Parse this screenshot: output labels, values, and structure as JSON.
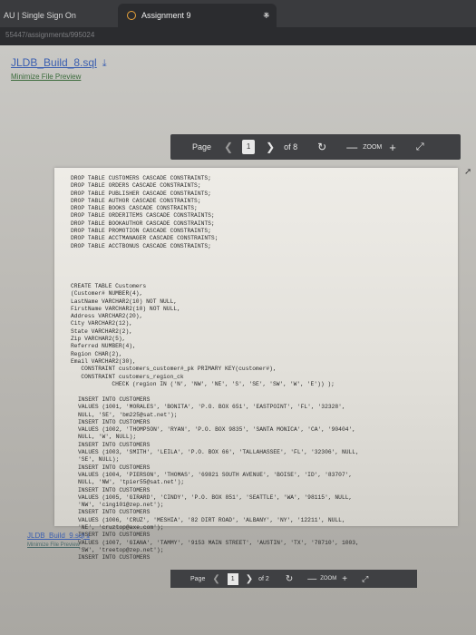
{
  "browser": {
    "tabs": [
      {
        "label": "AU | Single Sign On"
      },
      {
        "label": "Assignment 9"
      }
    ],
    "tab_close": "×",
    "new_tab": "+",
    "url": "55447/assignments/995024"
  },
  "file1": {
    "name": "JLDB_Build_8.sql",
    "minimize_label": "Minimize File Preview",
    "toolbar": {
      "page_label": "Page",
      "current_page": "1",
      "of_label": "of 8",
      "zoom_label": "ZOOM",
      "minus": "—",
      "plus": "+"
    }
  },
  "file2": {
    "name": "JLDB_Build_9.sql",
    "minimize_label": "Minimize File Preview",
    "toolbar": {
      "page_label": "Page",
      "current_page": "1",
      "of_label": "of 2",
      "zoom_label": "ZOOM",
      "minus": "—",
      "plus": "+"
    }
  },
  "icons": {
    "download": "download-icon",
    "prev": "chevron-left-icon",
    "next": "chevron-right-icon",
    "refresh": "refresh-icon",
    "expand": "expand-icon"
  },
  "document": {
    "drop_block": "DROP TABLE CUSTOMERS CASCADE CONSTRAINTS;\nDROP TABLE ORDERS CASCADE CONSTRAINTS;\nDROP TABLE PUBLISHER CASCADE CONSTRAINTS;\nDROP TABLE AUTHOR CASCADE CONSTRAINTS;\nDROP TABLE BOOKS CASCADE CONSTRAINTS;\nDROP TABLE ORDERITEMS CASCADE CONSTRAINTS;\nDROP TABLE BOOKAUTHOR CASCADE CONSTRAINTS;\nDROP TABLE PROMOTION CASCADE CONSTRAINTS;\nDROP TABLE ACCTMANAGER CASCADE CONSTRAINTS;\nDROP TABLE ACCTBONUS CASCADE CONSTRAINTS;",
    "create_block": "CREATE TABLE Customers\n(Customer# NUMBER(4),\nLastName VARCHAR2(10) NOT NULL,\nFirstName VARCHAR2(10) NOT NULL,\nAddress VARCHAR2(20),\nCity VARCHAR2(12),\nState VARCHAR2(2),\nZip VARCHAR2(5),\nReferred NUMBER(4),\nRegion CHAR(2),\nEmail VARCHAR2(30),\n   CONSTRAINT customers_customer#_pk PRIMARY KEY(customer#),\n   CONSTRAINT customers_region_ck\n            CHECK (region IN ('N', 'NW', 'NE', 'S', 'SE', 'SW', 'W', 'E')) );",
    "insert_block": "INSERT INTO CUSTOMERS\nVALUES (1001, 'MORALES', 'BONITA', 'P.O. BOX 651', 'EASTPOINT', 'FL', '32328',\nNULL, 'SE', 'bm225@sat.net');\nINSERT INTO CUSTOMERS\nVALUES (1002, 'THOMPSON', 'RYAN', 'P.O. BOX 9835', 'SANTA MONICA', 'CA', '90404',\nNULL, 'W', NULL);\nINSERT INTO CUSTOMERS\nVALUES (1003, 'SMITH', 'LEILA', 'P.O. BOX 66', 'TALLAHASSEE', 'FL', '32306', NULL,\n'SE', NULL);\nINSERT INTO CUSTOMERS\nVALUES (1004, 'PIERSON', 'THOMAS', '69821 SOUTH AVENUE', 'BOISE', 'ID', '83707',\nNULL, 'NW', 'tpier55@sat.net');\nINSERT INTO CUSTOMERS\nVALUES (1005, 'GIRARD', 'CINDY', 'P.O. BOX 851', 'SEATTLE', 'WA', '98115', NULL,\n'NW', 'cing101@zep.net');\nINSERT INTO CUSTOMERS\nVALUES (1006, 'CRUZ', 'MESHIA', '82 DIRT ROAD', 'ALBANY', 'NY', '12211', NULL,\n'NE', 'cruztop@axe.com');\nINSERT INTO CUSTOMERS\nVALUES (1007, 'GIANA', 'TAMMY', '9153 MAIN STREET', 'AUSTIN', 'TX', '78710', 1003,\n'SW', 'treetop@zep.net');\nINSERT INTO CUSTOMERS"
  }
}
